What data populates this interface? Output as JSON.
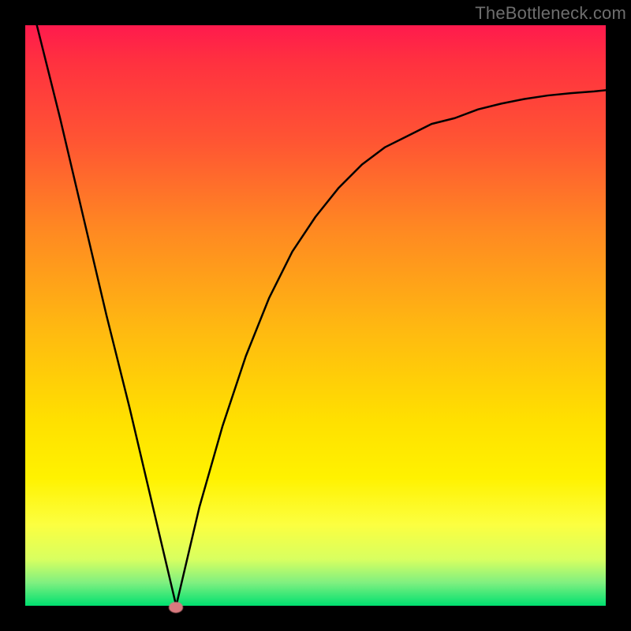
{
  "watermark": "TheBottleneck.com",
  "chart_data": {
    "type": "line",
    "title": "",
    "xlabel": "",
    "ylabel": "",
    "xlim": [
      0,
      1
    ],
    "ylim": [
      0,
      1
    ],
    "grid": false,
    "legend": false,
    "marker": {
      "present": true,
      "x": 0.26,
      "y": 0.0,
      "color": "#d97a7f"
    },
    "series": [
      {
        "name": "curve",
        "color": "#000000",
        "x": [
          0.02,
          0.06,
          0.1,
          0.14,
          0.18,
          0.22,
          0.26,
          0.3,
          0.34,
          0.38,
          0.42,
          0.46,
          0.5,
          0.54,
          0.58,
          0.62,
          0.66,
          0.7,
          0.74,
          0.78,
          0.82,
          0.86,
          0.9,
          0.94,
          0.98,
          1.0
        ],
        "y": [
          1.0,
          0.84,
          0.67,
          0.5,
          0.34,
          0.17,
          0.0,
          0.17,
          0.31,
          0.43,
          0.53,
          0.61,
          0.67,
          0.72,
          0.76,
          0.79,
          0.81,
          0.83,
          0.84,
          0.855,
          0.865,
          0.873,
          0.879,
          0.883,
          0.886,
          0.888
        ]
      }
    ],
    "background_gradient_stops": [
      {
        "pos": 0.0,
        "color": "#ff1a4d"
      },
      {
        "pos": 0.06,
        "color": "#ff3040"
      },
      {
        "pos": 0.2,
        "color": "#ff5533"
      },
      {
        "pos": 0.35,
        "color": "#ff8822"
      },
      {
        "pos": 0.52,
        "color": "#ffb811"
      },
      {
        "pos": 0.68,
        "color": "#ffe000"
      },
      {
        "pos": 0.78,
        "color": "#fff200"
      },
      {
        "pos": 0.86,
        "color": "#fcff40"
      },
      {
        "pos": 0.92,
        "color": "#d8ff60"
      },
      {
        "pos": 0.96,
        "color": "#80f080"
      },
      {
        "pos": 1.0,
        "color": "#00e070"
      }
    ]
  }
}
